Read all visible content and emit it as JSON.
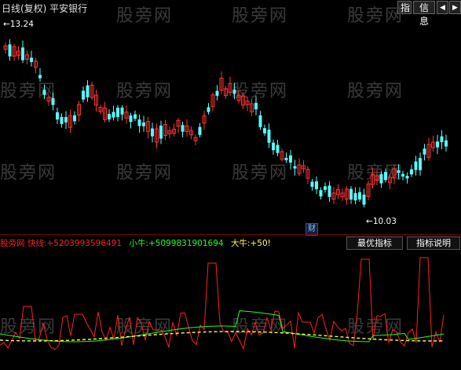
{
  "header": {
    "title": "日线(复权)  平安银行",
    "btn_indicator": "指",
    "btn_info": "信息",
    "btn_prev": "◀",
    "btn_next": "▶"
  },
  "watermark": "股旁网",
  "price_chart": {
    "high_label": "13.24",
    "low_label": "10.03",
    "event_badge": "财",
    "colors": {
      "up": "#ff3232",
      "down": "#54ffff"
    }
  },
  "indicator": {
    "name_partial": "股旁网",
    "fast_line_label": "快线:",
    "fast_line_value": "+5203993596491",
    "small_bull_label": "小牛:",
    "small_bull_value": "+5099831901694",
    "big_bull_label": "大牛:",
    "big_bull_value": "+50!",
    "btn_best": "最优指标",
    "btn_help": "指标说明",
    "colors": {
      "fast": "#ff2020",
      "small": "#20ff20",
      "big": "#ffff40"
    }
  }
}
